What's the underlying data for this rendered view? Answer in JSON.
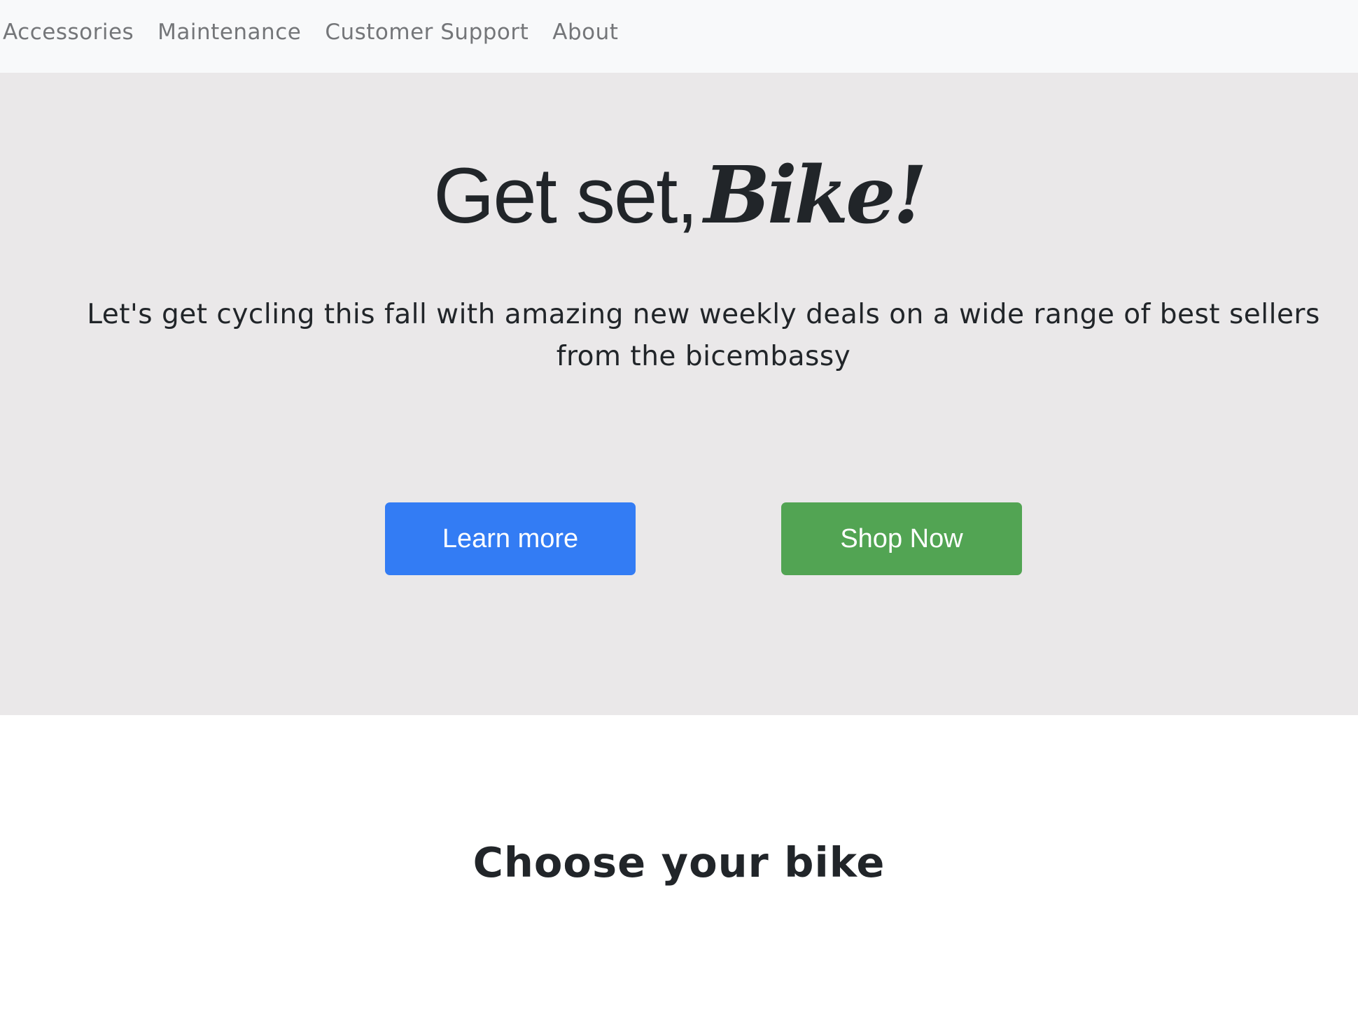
{
  "nav": {
    "items": [
      {
        "label": "Accessories"
      },
      {
        "label": "Maintenance"
      },
      {
        "label": "Customer Support"
      },
      {
        "label": "About"
      }
    ]
  },
  "hero": {
    "title_plain": "Get set,",
    "title_fancy": "Bike!",
    "lead": "Let's get cycling this fall with amazing new weekly deals on a wide range of best sellers from the bicembassy",
    "learn_more_label": "Learn more",
    "shop_now_label": "Shop Now"
  },
  "section": {
    "title": "Choose your bike"
  },
  "colors": {
    "navbar_bg": "#f8f9fa",
    "hero_bg": "#eae8e9",
    "primary_button": "#337cf4",
    "success_button": "#52a453",
    "text": "#212529",
    "nav_text": "#747679"
  }
}
